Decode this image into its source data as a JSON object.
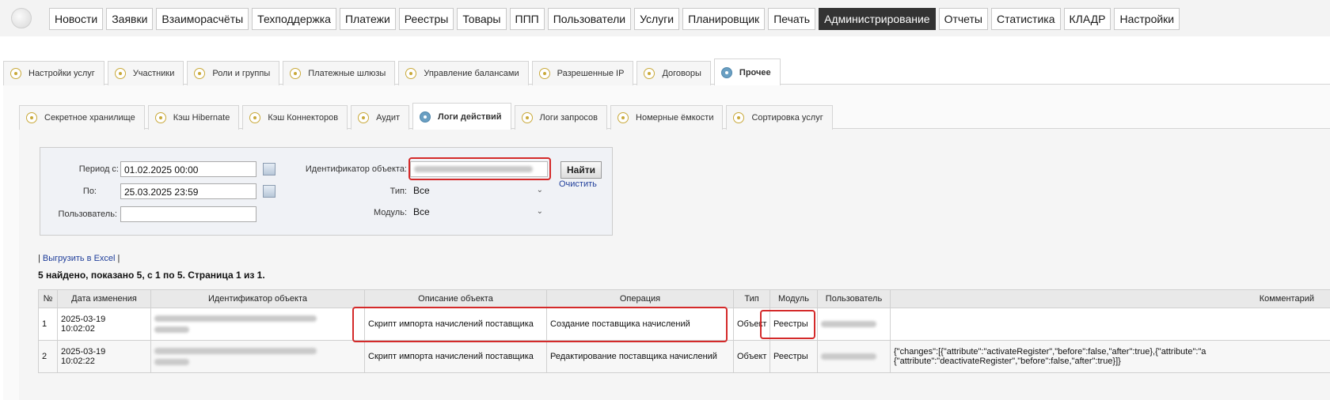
{
  "menu": {
    "items": [
      "Новости",
      "Заявки",
      "Взаиморасчёты",
      "Техподдержка",
      "Платежи",
      "Реестры",
      "Товары",
      "ППП",
      "Пользователи",
      "Услуги",
      "Планировщик",
      "Печать",
      "Администрирование",
      "Отчеты",
      "Статистика",
      "КЛАДР",
      "Настройки"
    ],
    "active_index": 12
  },
  "tabs_level1": [
    "Настройки услуг",
    "Участники",
    "Роли и группы",
    "Платежные шлюзы",
    "Управление балансами",
    "Разрешенные IP",
    "Договоры",
    "Прочее"
  ],
  "tabs_level1_active": 7,
  "tabs_level2": [
    "Секретное хранилище",
    "Кэш Hibernate",
    "Кэш Коннекторов",
    "Аудит",
    "Логи действий",
    "Логи запросов",
    "Номерные ёмкости",
    "Сортировка услуг"
  ],
  "tabs_level2_active": 4,
  "filter": {
    "period_from_label": "Период с:",
    "period_from_value": "01.02.2025 00:00",
    "period_to_label": "По:",
    "period_to_value": "25.03.2025 23:59",
    "user_label": "Пользователь:",
    "user_value": "",
    "object_id_label": "Идентификатор объекта:",
    "type_label": "Тип:",
    "type_value": "Все",
    "module_label": "Модуль:",
    "module_value": "Все",
    "find_button": "Найти",
    "clear_link": "Очистить"
  },
  "results": {
    "export_prefix": "|",
    "export_link": "Выгрузить в Excel",
    "export_suffix": "|",
    "summary": "5 найдено, показано 5, с 1 по 5. Страница 1 из 1.",
    "columns": [
      "№",
      "Дата изменения",
      "Идентификатор объекта",
      "Описание объекта",
      "Операция",
      "Тип",
      "Модуль",
      "Пользователь",
      "Комментарий"
    ],
    "rows": [
      {
        "num": "1",
        "date": "2025-03-19",
        "time": "10:02:02",
        "description": "Скрипт импорта начислений поставщика",
        "operation": "Создание поставщика начислений",
        "type": "Объект",
        "module": "Реестры",
        "comment_line1": "",
        "comment_line2": ""
      },
      {
        "num": "2",
        "date": "2025-03-19",
        "time": "10:02:22",
        "description": "Скрипт импорта начислений поставщика",
        "operation": "Редактирование поставщика начислений",
        "type": "Объект",
        "module": "Реестры",
        "comment_line1": "{\"changes\":[{\"attribute\":\"activateRegister\",\"before\":false,\"after\":true},{\"attribute\":\"a",
        "comment_line2": "{\"attribute\":\"deactivateRegister\",\"before\":false,\"after\":true}]}"
      }
    ]
  },
  "colors": {
    "highlight": "#d42a2a",
    "link": "#1f3e9a",
    "active_menu": "#333333"
  }
}
